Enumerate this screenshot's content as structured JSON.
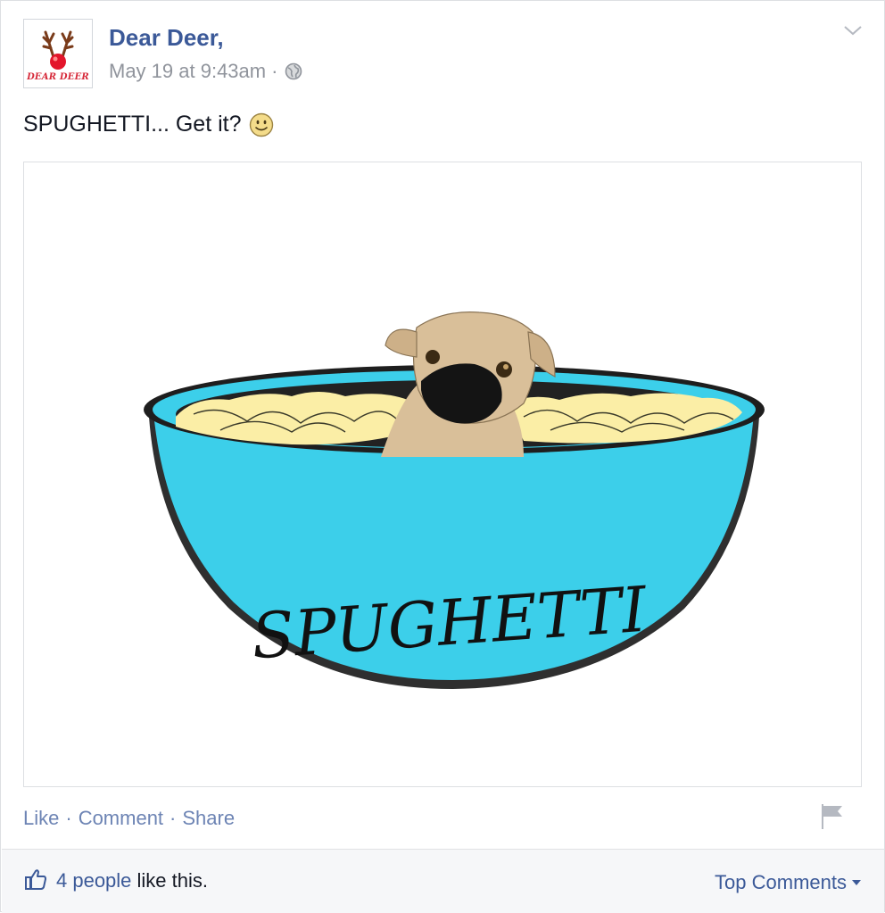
{
  "post": {
    "page_name": "Dear Deer,",
    "timestamp": "May 19 at 9:43am",
    "separator": "·",
    "text": "SPUGHETTI... Get it?",
    "avatar_text": "DEAR DEER",
    "image_caption_text": "SPUGHETTI"
  },
  "actions": {
    "like": "Like",
    "comment": "Comment",
    "share": "Share",
    "separator": "·"
  },
  "footer": {
    "likes_people": "4 people",
    "likes_suffix": " like this.",
    "top_comments": "Top Comments"
  },
  "icons": {
    "chevron": "chevron-down-icon",
    "globe": "globe-icon",
    "smiley": "smiley-emoji",
    "flag": "flag-icon",
    "thumbs_up": "thumbs-up-icon"
  },
  "colors": {
    "brand_blue": "#3b5998",
    "link_blue": "#6d84b4",
    "meta_gray": "#90949c",
    "bowl_cyan": "#3ccfea"
  }
}
